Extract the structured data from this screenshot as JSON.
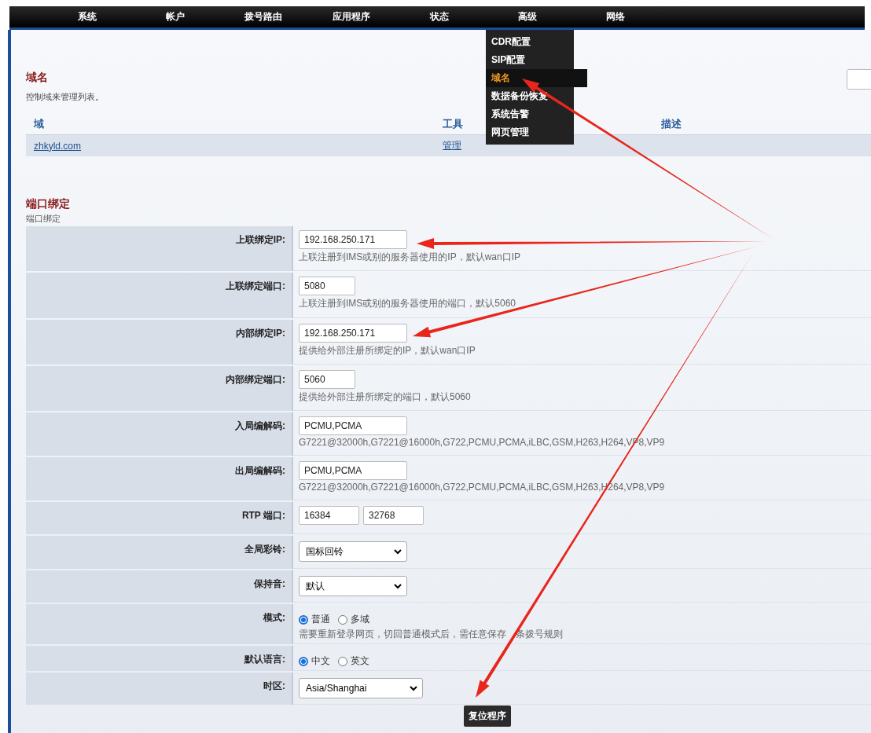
{
  "nav": [
    {
      "label": "系统"
    },
    {
      "label": "帐户"
    },
    {
      "label": "拨号路由"
    },
    {
      "label": "应用程序"
    },
    {
      "label": "状态"
    },
    {
      "label": "高级"
    },
    {
      "label": "网络"
    }
  ],
  "dropdown": [
    {
      "label": "CDR配置",
      "selected": false
    },
    {
      "label": "SIP配置",
      "selected": false
    },
    {
      "label": "域名",
      "selected": true
    },
    {
      "label": "数据备份恢复",
      "selected": false
    },
    {
      "label": "系统告警",
      "selected": false
    },
    {
      "label": "网页管理",
      "selected": false
    }
  ],
  "domain_section": {
    "title": "域名",
    "subtitle": "控制域来管理列表。",
    "columns": [
      "域",
      "工具",
      "描述"
    ],
    "rows": [
      {
        "domain": "zhkyld.com",
        "tool": "管理"
      }
    ]
  },
  "port_section": {
    "title": "端口绑定",
    "subtitle": "端口绑定",
    "rows": [
      {
        "kind": "text",
        "label": "上联绑定IP:",
        "values": [
          "192.168.250.171"
        ],
        "hint": "上联注册到IMS或别的服务器使用的IP，默认wan口IP"
      },
      {
        "kind": "text",
        "label": "上联绑定端口:",
        "values": [
          "5080"
        ],
        "hint": "上联注册到IMS或别的服务器使用的端口，默认5060"
      },
      {
        "kind": "text",
        "label": "内部绑定IP:",
        "values": [
          "192.168.250.171"
        ],
        "hint": "提供给外部注册所绑定的IP，默认wan口IP"
      },
      {
        "kind": "text",
        "label": "内部绑定端口:",
        "values": [
          "5060"
        ],
        "hint": "提供给外部注册所绑定的端口，默认5060"
      },
      {
        "kind": "text",
        "label": "入局编解码:",
        "values": [
          "PCMU,PCMA"
        ],
        "hint": "G7221@32000h,G7221@16000h,G722,PCMU,PCMA,iLBC,GSM,H263,H264,VP8,VP9"
      },
      {
        "kind": "text",
        "label": "出局编解码:",
        "values": [
          "PCMU,PCMA"
        ],
        "hint": "G7221@32000h,G7221@16000h,G722,PCMU,PCMA,iLBC,GSM,H263,H264,VP8,VP9"
      },
      {
        "kind": "text",
        "label": "RTP 端口:",
        "values": [
          "16384",
          "32768"
        ]
      },
      {
        "kind": "select",
        "label": "全局彩铃:",
        "value": "国标回铃"
      },
      {
        "kind": "select",
        "label": "保持音:",
        "value": "默认"
      },
      {
        "kind": "radio",
        "label": "模式:",
        "options": [
          {
            "label": "普通",
            "selected": true
          },
          {
            "label": "多域",
            "selected": false
          }
        ],
        "hint": [
          "需要重新登录网页，切回普通模式后，需任意保存",
          "条拨号规则"
        ]
      },
      {
        "kind": "radio",
        "label": "默认语言:",
        "options": [
          {
            "label": "中文",
            "selected": true
          },
          {
            "label": "英文",
            "selected": false
          }
        ]
      },
      {
        "kind": "select",
        "label": "时区:",
        "value": "Asia/Shanghai"
      }
    ]
  },
  "reset_button": "复位程序"
}
